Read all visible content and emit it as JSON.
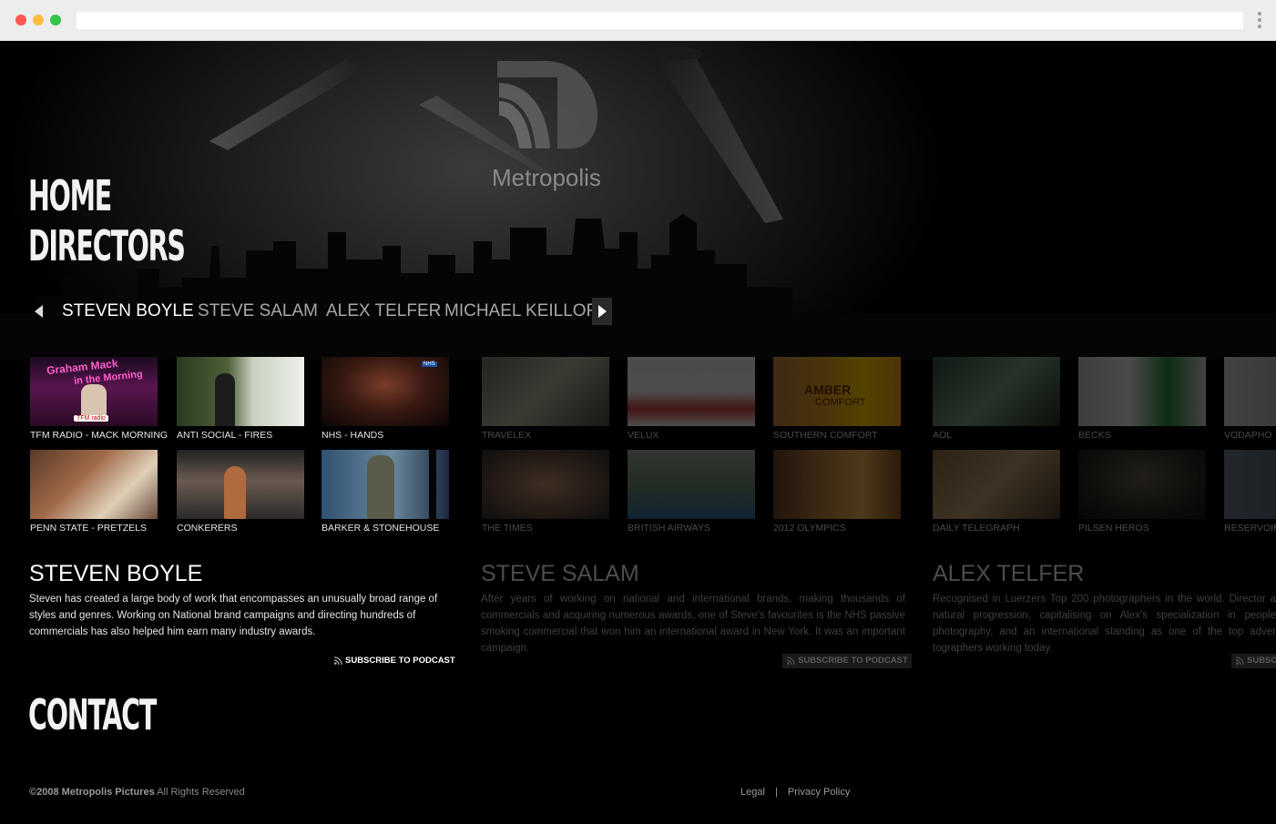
{
  "brand": {
    "logo_text": "Metropolis"
  },
  "nav": {
    "home": "HOME",
    "directors": "DIRECTORS",
    "contact": "CONTACT"
  },
  "selector": {
    "tabs": [
      "STEVEN BOYLE",
      "STEVE SALAM",
      "ALEX TELFER",
      "MICHAEL KEILLOR"
    ],
    "active": "STEVEN BOYLE"
  },
  "directors": [
    {
      "name": "STEVEN BOYLE",
      "bio": "Steven has created a large body of work that encompasses an unusually broad range of styles and genres. Working on National brand campaigns and directing hundreds of commercials has also helped him earn many industry awards.",
      "podcast": "SUBSCRIBE TO PODCAST",
      "works": [
        "TFM RADIO - MACK MORNING",
        "ANTI SOCIAL - FIRES",
        "NHS - HANDS",
        "PENN STATE - PRETZELS",
        "CONKERERS",
        "BARKER & STONEHOUSE"
      ],
      "thumb_text": {
        "graham": "Graham Mack",
        "morning": "in the Morning",
        "tfm": "TFM radio",
        "nhs": "NHS"
      }
    },
    {
      "name": "STEVE SALAM",
      "bio": "After years of working on national and international brands, making thousands of commercials and acquiring numerous awards, one of Steve's favourites is the NHS passive smoking commercial that won him an international award in New York. It was an important campaign.",
      "podcast": "SUBSCRIBE TO PODCAST",
      "works": [
        "TRAVELEX",
        "VELUX",
        "SOUTHERN COMFORT",
        "THE TIMES",
        "BRITISH AIRWAYS",
        "2012 OLYMPICS"
      ],
      "thumb_text": {
        "amber": "AMBER",
        "comfort": "COMFORT"
      }
    },
    {
      "name": "ALEX TELFER",
      "bio": "Recognised in Luerzers Top 200 photographers in the world. Director a natural progression, capitalising on Alex's specialization in people photography, and an international standing as one of the top adver tographers working today.",
      "podcast": "SUBSC",
      "works": [
        "AOL",
        "BECKS",
        "VODAPHO",
        "DAILY TELEGRAPH",
        "PILSEN HEROS",
        "RESERVOIR"
      ]
    }
  ],
  "footer": {
    "copyright": "©2008 Metropolis Pictures",
    "rights": "All Rights Reserved",
    "legal": "Legal",
    "separator": "|",
    "privacy": "Privacy Policy"
  },
  "colors": {
    "background": "#000000",
    "text": "#ffffff",
    "dim_text": "#4c4c4c"
  }
}
